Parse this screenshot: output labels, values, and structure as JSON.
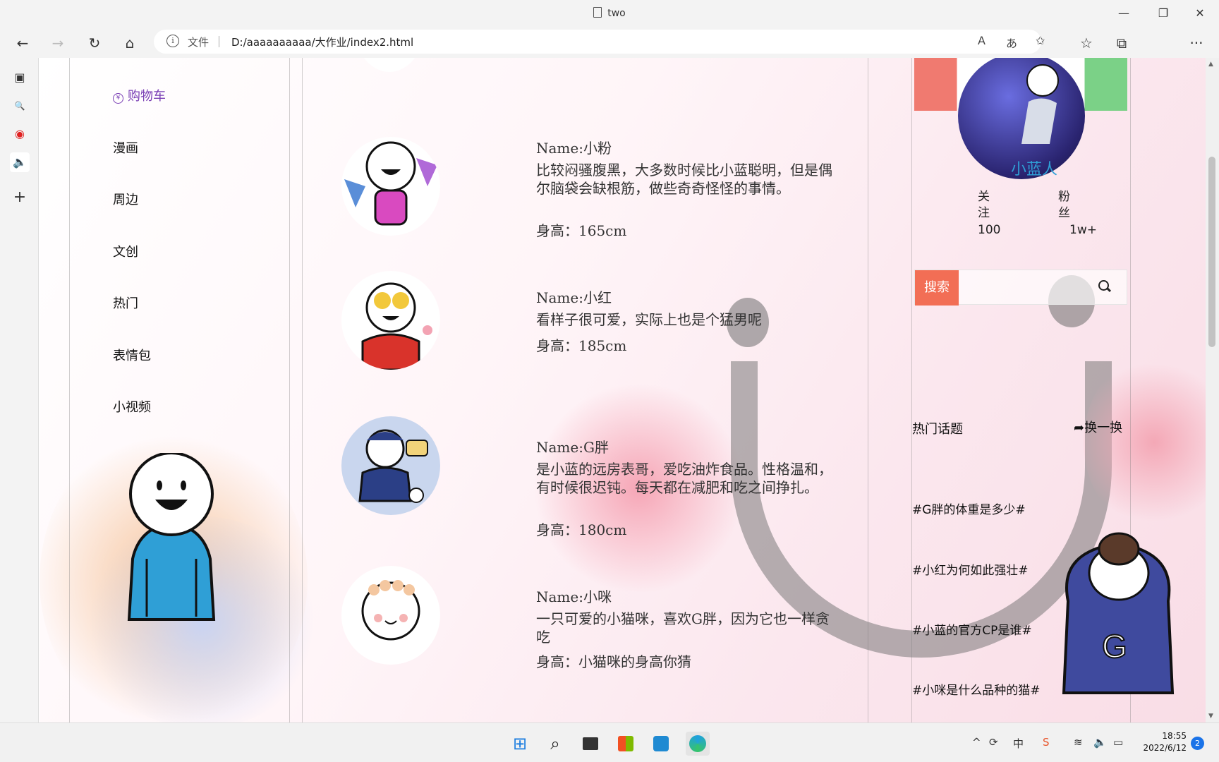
{
  "window": {
    "title": "two",
    "minimize": "—",
    "restore": "❐",
    "close": "✕"
  },
  "toolbar": {
    "back": "←",
    "forward": "→",
    "refresh": "↻",
    "home": "⌂",
    "favorites": "☆",
    "collections": "⧉",
    "more": "···"
  },
  "address": {
    "info_icon": "i",
    "file_label": "文件",
    "url": "D:/aaaaaaaaaa/大作业/index2.html",
    "read_aloud": "A",
    "translate": "あ",
    "add_favorite": "✩"
  },
  "sidestrip": {
    "tabs": "▣",
    "search": "🔍",
    "record": "◉",
    "audio": "🔈",
    "add": "+"
  },
  "nav": {
    "cart_icon": "¥",
    "items": [
      "购物车",
      "漫画",
      "周边",
      "文创",
      "热门",
      "表情包",
      "小视频"
    ]
  },
  "characters": [
    {
      "name": "Name:小粉",
      "desc": "比较闷骚腹黑，大多数时候比小蓝聪明，但是偶尔脑袋会缺根筋，做些奇奇怪怪的事情。",
      "height": "身高：165cm"
    },
    {
      "name": "Name:小红",
      "desc": "看样子很可爱，实际上也是个猛男呢",
      "height": "身高：185cm"
    },
    {
      "name": "Name:G胖",
      "desc": "是小蓝的远房表哥，爱吃油炸食品。性格温和，有时候很迟钝。每天都在减肥和吃之间挣扎。",
      "height": "身高：180cm"
    },
    {
      "name": "Name:小咪",
      "desc": "一只可爱的小猫咪，喜欢G胖，因为它也一样贪吃",
      "height": "身高：小猫咪的身高你猜"
    }
  ],
  "profile": {
    "name": "小蓝人",
    "follow_label": "关注",
    "follow_value": "100",
    "fans_label": "粉丝",
    "fans_value": "1w+"
  },
  "search": {
    "button": "搜索",
    "icon": "search-icon"
  },
  "topics": {
    "title": "热门话题",
    "refresh": "换一换",
    "refresh_icon": "➦",
    "items": [
      "#G胖的体重是多少#",
      "#小红为何如此强壮#",
      "#小蓝的官方CP是谁#",
      "#小咪是什么品种的猫#"
    ]
  },
  "taskbar": {
    "start": "⊞",
    "search": "⌕",
    "chevron": "^",
    "lang": "中",
    "time": "18:55",
    "date": "2022/6/12",
    "notifications": "2"
  },
  "colors": {
    "accent_purple": "#7a3fb5",
    "search_orange": "#f26e55",
    "name_blue": "#2f9fd6",
    "blue_shirt": "#2f9fd6"
  }
}
